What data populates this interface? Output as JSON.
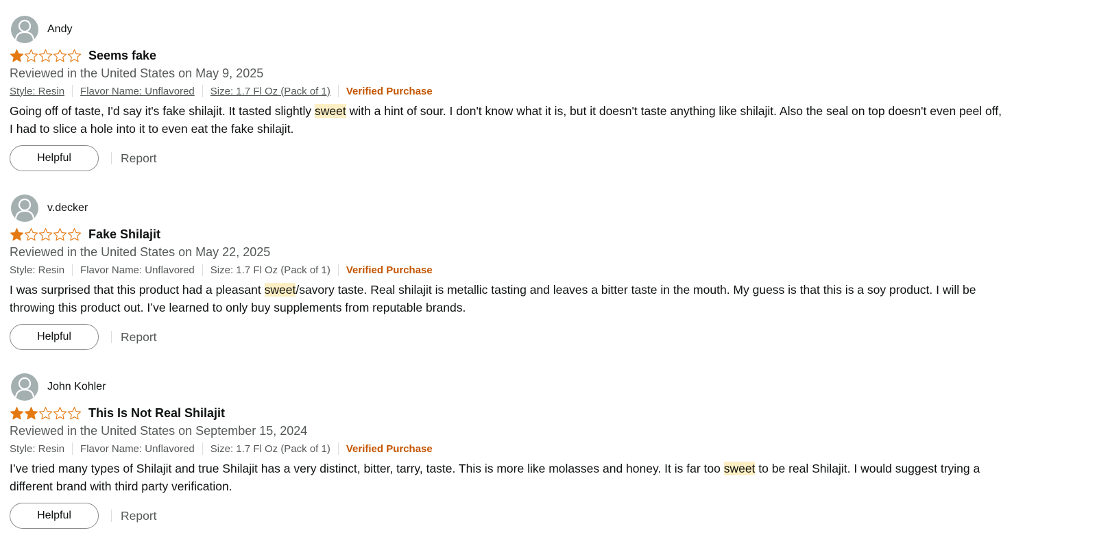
{
  "colors": {
    "star_fill": "#e47911",
    "verified": "#c45500",
    "highlight": "#fdefc3",
    "avatar": "#a4afb0",
    "meta_text": "#565959"
  },
  "reviews": [
    {
      "author": "Andy",
      "rating": 1,
      "max_rating": 5,
      "title": "Seems fake",
      "date": "Reviewed in the United States on May 9, 2025",
      "style": "Style: Resin",
      "flavor": "Flavor Name: Unflavored",
      "size": "Size: 1.7 Fl Oz (Pack of 1)",
      "verified": "Verified Purchase",
      "body_before": "Going off of taste, I'd say it's fake shilajit. It tasted slightly ",
      "body_highlight": "sweet",
      "body_after": " with a hint of sour. I don't know what it is, but it doesn't taste anything like shilajit. Also the seal on top doesn't even peel off, I had to slice a hole into it to even eat the fake shilajit.",
      "helpful_label": "Helpful",
      "report_label": "Report"
    },
    {
      "author": "v.decker",
      "rating": 1,
      "max_rating": 5,
      "title": "Fake Shilajit",
      "date": "Reviewed in the United States on May 22, 2025",
      "style": "Style: Resin",
      "flavor": "Flavor Name: Unflavored",
      "size": "Size: 1.7 Fl Oz (Pack of 1)",
      "verified": "Verified Purchase",
      "body_before": "I was surprised that this product had a pleasant ",
      "body_highlight": "sweet",
      "body_after": "/savory taste. Real shilajit is metallic tasting and leaves a bitter taste in the mouth. My guess is that this is a soy product. I will be throwing this product out. I’ve learned to only buy supplements from reputable brands.",
      "helpful_label": "Helpful",
      "report_label": "Report"
    },
    {
      "author": "John Kohler",
      "rating": 2,
      "max_rating": 5,
      "title": "This Is Not Real Shilajit",
      "date": "Reviewed in the United States on September 15, 2024",
      "style": "Style: Resin",
      "flavor": "Flavor Name: Unflavored",
      "size": "Size: 1.7 Fl Oz (Pack of 1)",
      "verified": "Verified Purchase",
      "body_before": "I’ve tried many types of Shilajit and true Shilajit has a very distinct, bitter, tarry, taste. This is more like molasses and honey. It is far too ",
      "body_highlight": "sweet",
      "body_after": " to be real Shilajit. I would suggest trying a different brand with third party verification.",
      "helpful_label": "Helpful",
      "report_label": "Report"
    }
  ]
}
